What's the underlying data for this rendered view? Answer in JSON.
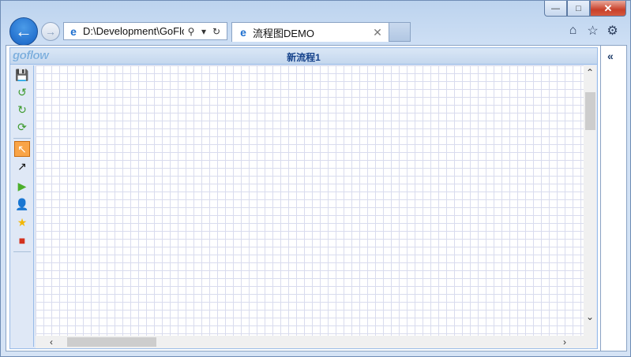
{
  "window": {
    "minimize_glyph": "—",
    "maximize_glyph": "□",
    "close_glyph": "✕"
  },
  "nav": {
    "back_glyph": "←",
    "forward_glyph": "→",
    "address": {
      "favicon": "e",
      "url": "D:\\Development\\GoFlow",
      "search_glyph": "⚲",
      "dropdown_glyph": "▾",
      "refresh_glyph": "↻"
    }
  },
  "tab": {
    "favicon": "e",
    "title": "流程图DEMO",
    "close_glyph": "✕"
  },
  "tools": {
    "home_glyph": "⌂",
    "favorites_glyph": "☆",
    "settings_glyph": "⚙"
  },
  "sidepane": {
    "collapse_glyph": "«"
  },
  "flow": {
    "logo": "goflow",
    "title": "新流程1",
    "toolbar": [
      {
        "name": "save",
        "glyph": "💾",
        "color": "#2b4f8c"
      },
      {
        "name": "undo",
        "glyph": "↺",
        "color": "#3c9a2c"
      },
      {
        "name": "redo",
        "glyph": "↻",
        "color": "#3c9a2c"
      },
      {
        "name": "refresh",
        "glyph": "⟳",
        "color": "#3c9a2c"
      },
      {
        "name": "select",
        "glyph": "↖",
        "color": "#ffffff"
      },
      {
        "name": "line",
        "glyph": "↗",
        "color": "#111111"
      },
      {
        "name": "start",
        "glyph": "▶",
        "color": "#4caf2c"
      },
      {
        "name": "user-task",
        "glyph": "👤",
        "color": "#c45b2a"
      },
      {
        "name": "star",
        "glyph": "★",
        "color": "#f2b705"
      },
      {
        "name": "end",
        "glyph": "■",
        "color": "#d3321e"
      }
    ],
    "scroll": {
      "up": "⌃",
      "down": "⌄",
      "left": "‹",
      "right": "›"
    }
  }
}
